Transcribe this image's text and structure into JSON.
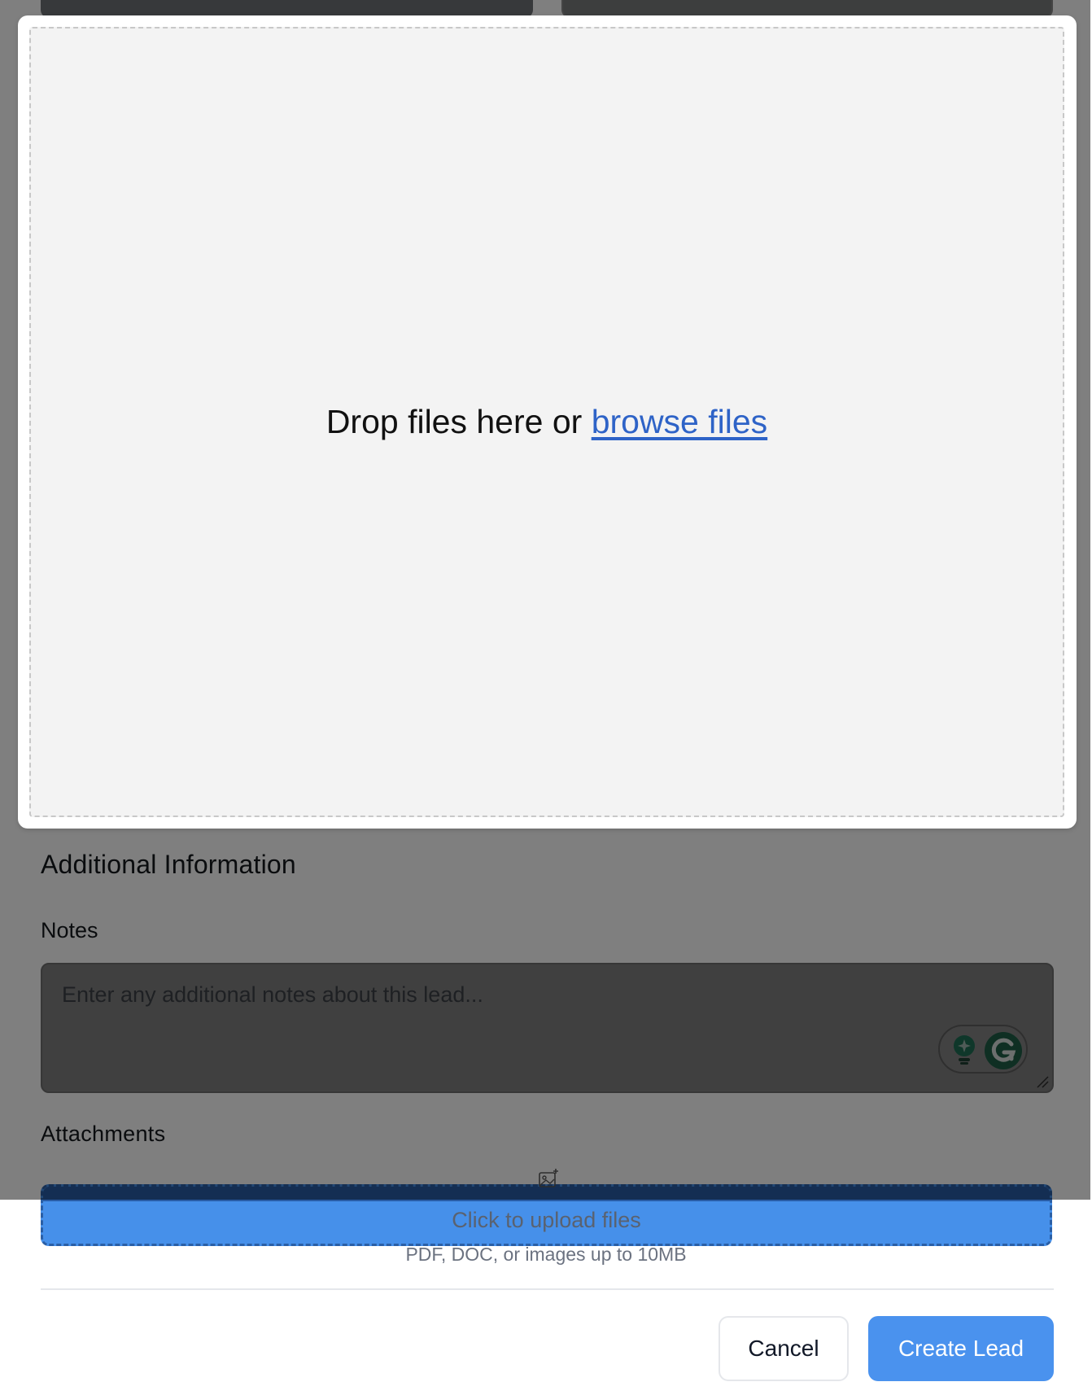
{
  "form": {
    "section_title": "Additional Information",
    "notes_label": "Notes",
    "notes_placeholder": "Enter any additional notes about this lead...",
    "attachments_label": "Attachments",
    "upload_text": "Click to upload files",
    "upload_hint": "PDF, DOC, or images up to 10MB",
    "upload_icon": "image-plus-icon"
  },
  "footer": {
    "cancel_label": "Cancel",
    "create_label": "Create Lead"
  },
  "drop_overlay": {
    "prompt": "Drop files here or",
    "browse_link": "browse files"
  },
  "grammarly": {
    "icons": [
      "lightbulb-icon",
      "grammarly-g-icon"
    ]
  },
  "colors": {
    "primary": "#4a92ee",
    "link": "#2e63c7",
    "grammarly_green": "#1f6f55"
  }
}
